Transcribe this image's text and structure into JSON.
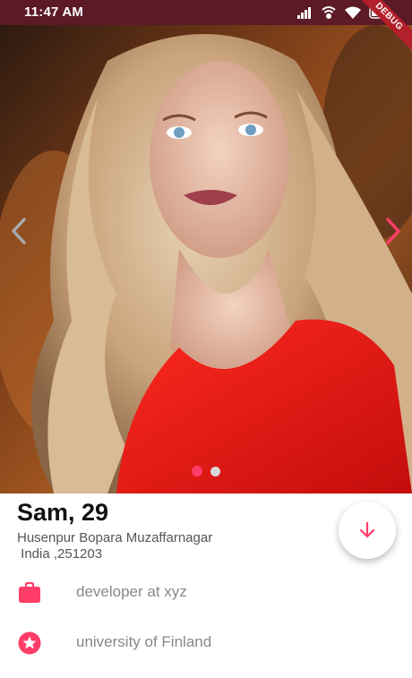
{
  "status_bar": {
    "time": "11:47 AM",
    "debug_label": "DEBUG"
  },
  "profile": {
    "name_age": "Sam, 29",
    "address_line1": "Husenpur Bopara  Muzaffarnagar",
    "address_line2": " India ,251203",
    "job": "developer at xyz",
    "school": "university of Finland"
  },
  "carousel": {
    "photo_count": 2,
    "active_index": 0
  },
  "colors": {
    "accent": "#ff3d68",
    "status_bar_bg": "#5b1a26",
    "text_secondary": "#888888"
  },
  "icons": {
    "prev": "chevron-left-icon",
    "next": "chevron-right-icon",
    "fab": "arrow-down-icon",
    "job": "briefcase-icon",
    "school": "star-circle-icon"
  }
}
